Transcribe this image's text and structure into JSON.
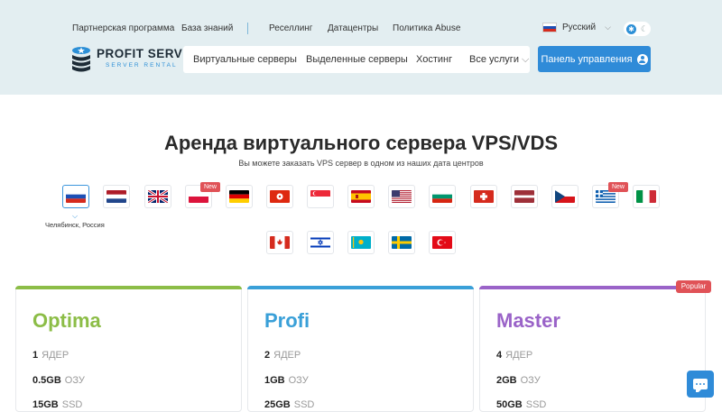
{
  "header": {
    "top_links": [
      "Партнерская программа",
      "База знаний",
      "Реселлинг",
      "Датацентры",
      "Политика Abuse"
    ],
    "language": "Русский",
    "logo": {
      "name": "PROFIT SERVER",
      "sub": "SERVER RENTAL"
    },
    "nav": [
      "Виртуальные серверы",
      "Выделенные серверы",
      "Хостинг",
      "Все услуги"
    ],
    "panel_button": "Панель управления"
  },
  "hero": {
    "title": "Аренда виртуального сервера VPS/VDS",
    "subtitle": "Вы можете заказать VPS сервер в одном из наших дата центров"
  },
  "locations": {
    "flags": [
      "russia",
      "netherlands",
      "united-kingdom",
      "poland",
      "germany",
      "hong-kong",
      "singapore",
      "spain",
      "usa",
      "bulgaria",
      "switzerland",
      "latvia",
      "czech-republic",
      "greece",
      "italy",
      "canada",
      "israel",
      "kazakhstan",
      "sweden",
      "turkey"
    ],
    "new_badge": "New",
    "selected": "Челябинск, Россия"
  },
  "plans": [
    {
      "name": "Optima",
      "color": "#8cbd47",
      "specs": [
        {
          "v": "1",
          "u": "ЯДЕР"
        },
        {
          "v": "0.5GB",
          "u": "ОЗУ"
        },
        {
          "v": "15GB",
          "u": "SSD"
        }
      ]
    },
    {
      "name": "Profi",
      "color": "#3aa0d8",
      "specs": [
        {
          "v": "2",
          "u": "ЯДЕР"
        },
        {
          "v": "1GB",
          "u": "ОЗУ"
        },
        {
          "v": "25GB",
          "u": "SSD"
        }
      ]
    },
    {
      "name": "Master",
      "color": "#9a63c8",
      "specs": [
        {
          "v": "4",
          "u": "ЯДЕР"
        },
        {
          "v": "2GB",
          "u": "ОЗУ"
        },
        {
          "v": "50GB",
          "u": "SSD"
        }
      ]
    }
  ],
  "popular_badge": "Popular"
}
